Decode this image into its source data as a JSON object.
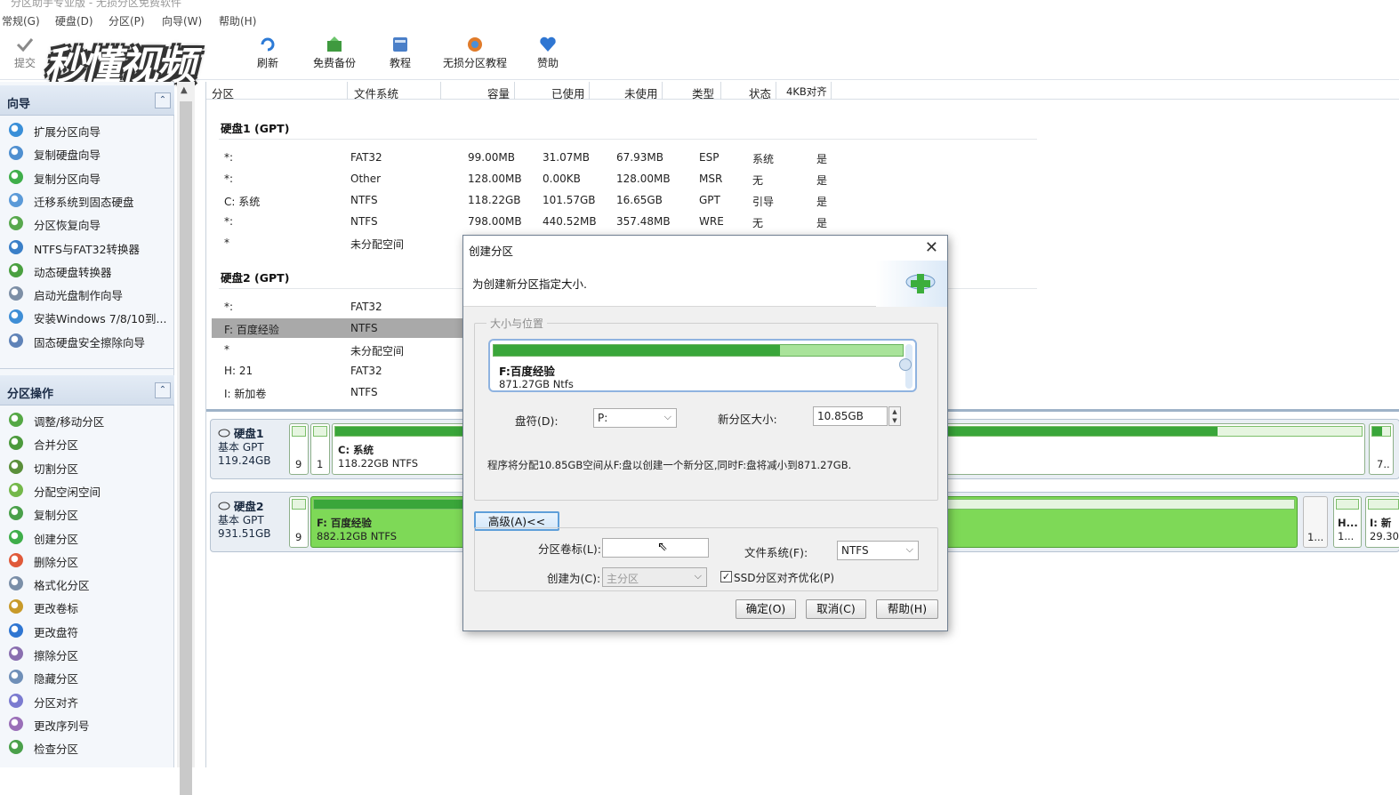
{
  "app": {
    "title": "分区助手专业版 - 无损分区免费软件"
  },
  "menu": [
    "常规(G)",
    "硬盘(D)",
    "分区(P)",
    "向导(W)",
    "帮助(H)"
  ],
  "toolbar": {
    "submit": "提交",
    "refresh": "刷新",
    "backup": "免费备份",
    "tutorial": "教程",
    "lossless": "无损分区教程",
    "donate": "赞助"
  },
  "watermark": "秒懂视频",
  "sidebar": {
    "wizard_title": "向导",
    "wizard_items": [
      "扩展分区向导",
      "复制硬盘向导",
      "复制分区向导",
      "迁移系统到固态硬盘",
      "分区恢复向导",
      "NTFS与FAT32转换器",
      "动态硬盘转换器",
      "启动光盘制作向导",
      "安装Windows 7/8/10到...",
      "固态硬盘安全擦除向导"
    ],
    "ops_title": "分区操作",
    "ops_items": [
      "调整/移动分区",
      "合并分区",
      "切割分区",
      "分配空闲空间",
      "复制分区",
      "创建分区",
      "删除分区",
      "格式化分区",
      "更改卷标",
      "更改盘符",
      "擦除分区",
      "隐藏分区",
      "分区对齐",
      "更改序列号",
      "检查分区"
    ]
  },
  "columns": [
    "分区",
    "文件系统",
    "容量",
    "已使用",
    "未使用",
    "类型",
    "状态",
    "4KB对齐"
  ],
  "disks": [
    {
      "title": "硬盘1 (GPT)",
      "rows": [
        {
          "name": "*:",
          "fs": "FAT32",
          "cap": "99.00MB",
          "used": "31.07MB",
          "free": "67.93MB",
          "type": "ESP",
          "status": "系统",
          "align": "是"
        },
        {
          "name": "*:",
          "fs": "Other",
          "cap": "128.00MB",
          "used": "0.00KB",
          "free": "128.00MB",
          "type": "MSR",
          "status": "无",
          "align": "是"
        },
        {
          "name": "C: 系统",
          "fs": "NTFS",
          "cap": "118.22GB",
          "used": "101.57GB",
          "free": "16.65GB",
          "type": "GPT",
          "status": "引导",
          "align": "是"
        },
        {
          "name": "*:",
          "fs": "NTFS",
          "cap": "798.00MB",
          "used": "440.52MB",
          "free": "357.48MB",
          "type": "WRE",
          "status": "无",
          "align": "是"
        },
        {
          "name": "*",
          "fs": "未分配空间",
          "cap": "",
          "used": "",
          "free": "",
          "type": "",
          "status": "",
          "align": ""
        }
      ]
    },
    {
      "title": "硬盘2 (GPT)",
      "rows": [
        {
          "name": "*:",
          "fs": "FAT32"
        },
        {
          "name": "F: 百度经验",
          "fs": "NTFS"
        },
        {
          "name": "*",
          "fs": "未分配空间"
        },
        {
          "name": "H: 21",
          "fs": "FAT32"
        },
        {
          "name": "I: 新加卷",
          "fs": "NTFS"
        }
      ]
    }
  ],
  "diskmap": {
    "disk1": {
      "name": "硬盘1",
      "type": "基本 GPT",
      "size": "119.24GB",
      "p1": "9",
      "p2": "1",
      "c_name": "C: 系统",
      "c_size": "118.22GB NTFS",
      "c_fill": 0.86,
      "tail": "7.."
    },
    "disk2": {
      "name": "硬盘2",
      "type": "基本 GPT",
      "size": "931.51GB",
      "p1": "9",
      "f_name": "F: 百度经验",
      "f_size": "882.12GB NTFS",
      "f_fill": 0.23,
      "u1": "1...",
      "h_name": "H...",
      "h_size": "1...",
      "i_name": "I: 新",
      "i_size": "29.30"
    }
  },
  "dialog": {
    "title": "创建分区",
    "header": "为创建新分区指定大小.",
    "group_title": "大小与位置",
    "part_name": "F:百度经验",
    "part_size": "871.27GB Ntfs",
    "part_fill": 0.7,
    "drive_label": "盘符(D):",
    "drive_value": "P:",
    "size_label": "新分区大小:",
    "size_value": "10.85GB",
    "info": "程序将分配10.85GB空间从F:盘以创建一个新分区,同时F:盘将减小到871.27GB.",
    "advanced": "高级(A)<<",
    "vol_label": "分区卷标(L):",
    "vol_value": "",
    "fs_label": "文件系统(F):",
    "fs_value": "NTFS",
    "create_as_label": "创建为(C):",
    "create_as_value": "主分区",
    "ssd_label": "SSD分区对齐优化(P)",
    "ssd_checked": true,
    "ok": "确定(O)",
    "cancel": "取消(C)",
    "help": "帮助(H)"
  }
}
